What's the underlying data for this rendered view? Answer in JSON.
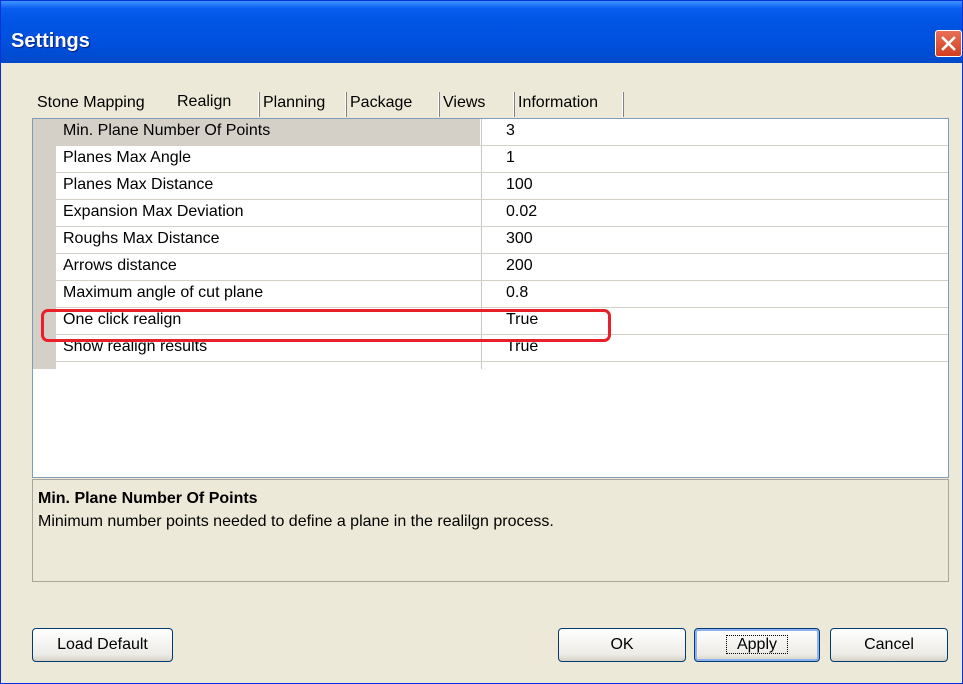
{
  "window": {
    "title": "Settings"
  },
  "tabs": [
    {
      "label": "Stone Mapping"
    },
    {
      "label": "Realign"
    },
    {
      "label": "Planning"
    },
    {
      "label": "Package"
    },
    {
      "label": "Views"
    },
    {
      "label": "Information"
    }
  ],
  "active_tab": "Realign",
  "properties": [
    {
      "name": "Min. Plane Number Of Points",
      "value": "3"
    },
    {
      "name": "Planes Max Angle",
      "value": "1"
    },
    {
      "name": "Planes Max Distance",
      "value": "100"
    },
    {
      "name": "Expansion Max Deviation",
      "value": "0.02"
    },
    {
      "name": "Roughs Max Distance",
      "value": "300"
    },
    {
      "name": "Arrows distance",
      "value": "200"
    },
    {
      "name": "Maximum angle of cut plane",
      "value": "0.8"
    },
    {
      "name": "One click realign",
      "value": "True"
    },
    {
      "name": "Show realign results",
      "value": "True"
    }
  ],
  "description": {
    "title": "Min. Plane Number Of Points",
    "text": "Minimum number points needed to define a plane in the realilgn process."
  },
  "buttons": {
    "load_default": "Load Default",
    "ok": "OK",
    "apply": "Apply",
    "cancel": "Cancel"
  },
  "colors": {
    "title_bar": "#0054e3",
    "annotation": "#e8202a"
  }
}
